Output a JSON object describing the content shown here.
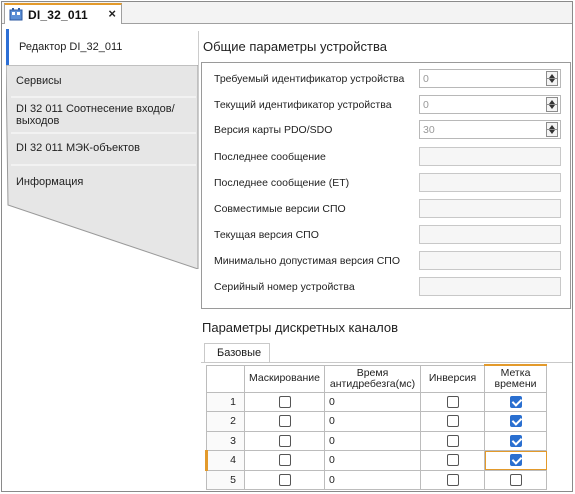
{
  "tab": {
    "title": "DI_32_011",
    "close": "×"
  },
  "nav": {
    "items": [
      {
        "label": "Редактор DI_32_011"
      },
      {
        "label": "Сервисы"
      },
      {
        "label": "DI 32 011 Соотнесение входов/выходов"
      },
      {
        "label": "DI 32 011 МЭК-объектов"
      },
      {
        "label": "Информация"
      }
    ]
  },
  "general": {
    "title": "Общие параметры устройства",
    "rows": [
      {
        "label": "Требуемый идентификатор устройства",
        "value": "0"
      },
      {
        "label": "Текущий идентификатор устройства",
        "value": "0"
      },
      {
        "label": "Версия карты PDO/SDO",
        "value": "30"
      },
      {
        "label": "Последнее сообщение",
        "value": ""
      },
      {
        "label": "Последнее сообщение (ET)",
        "value": ""
      },
      {
        "label": "Совместимые версии СПО",
        "value": ""
      },
      {
        "label": "Текущая версия СПО",
        "value": ""
      },
      {
        "label": "Минимально допустимая версия СПО",
        "value": ""
      },
      {
        "label": "Серийный номер устройства",
        "value": ""
      }
    ]
  },
  "channels": {
    "title": "Параметры дискретных каналов",
    "tab": "Базовые",
    "columns": {
      "mask": "Маскирование",
      "debounce": "Время антидребезга(мс)",
      "inversion": "Инверсия",
      "timestamp": "Метка времени"
    },
    "rows": [
      {
        "n": "1",
        "mask": false,
        "debounce": "0",
        "inversion": false,
        "timestamp": true
      },
      {
        "n": "2",
        "mask": false,
        "debounce": "0",
        "inversion": false,
        "timestamp": true
      },
      {
        "n": "3",
        "mask": false,
        "debounce": "0",
        "inversion": false,
        "timestamp": true
      },
      {
        "n": "4",
        "mask": false,
        "debounce": "0",
        "inversion": false,
        "timestamp": true
      },
      {
        "n": "5",
        "mask": false,
        "debounce": "0",
        "inversion": false,
        "timestamp": false
      }
    ]
  }
}
